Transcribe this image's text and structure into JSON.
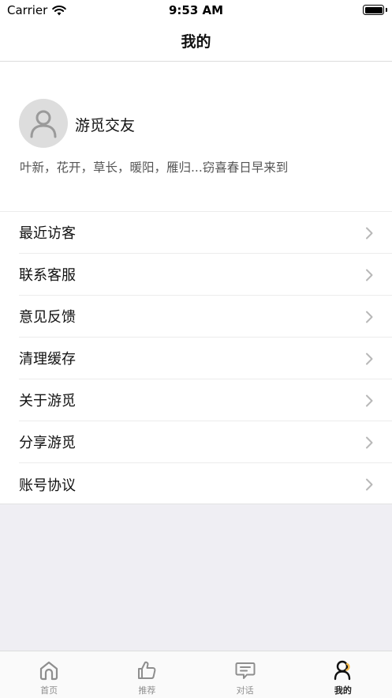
{
  "status_bar": {
    "carrier": "Carrier",
    "time": "9:53 AM"
  },
  "nav": {
    "title": "我的"
  },
  "profile": {
    "name": "游觅交友",
    "bio": "叶新，花开，草长，暖阳，雁归...窃喜春日早来到"
  },
  "menu": {
    "items": [
      {
        "label": "最近访客"
      },
      {
        "label": "联系客服"
      },
      {
        "label": "意见反馈"
      },
      {
        "label": "清理缓存"
      },
      {
        "label": "关于游觅"
      },
      {
        "label": "分享游觅"
      },
      {
        "label": "账号协议"
      }
    ]
  },
  "tab_bar": {
    "tabs": [
      {
        "label": "首页",
        "icon": "home-icon"
      },
      {
        "label": "推荐",
        "icon": "thumbs-up-icon"
      },
      {
        "label": "对话",
        "icon": "chat-icon"
      },
      {
        "label": "我的",
        "icon": "profile-icon"
      }
    ],
    "active_index": 3
  },
  "colors": {
    "background_gray": "#efeef3",
    "active_accent": "#f2b84b",
    "text_primary": "#111111",
    "text_secondary": "#555555"
  }
}
